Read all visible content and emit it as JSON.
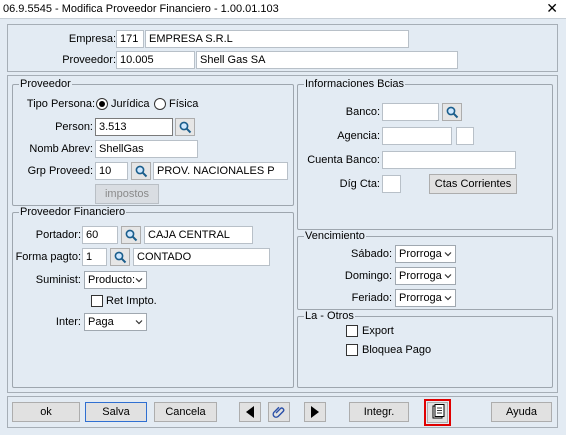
{
  "window": {
    "title": "06.9.5545 - Modifica Proveedor Financiero - 1.00.01.103"
  },
  "header": {
    "empresa_label": "Empresa:",
    "empresa_code": "171",
    "empresa_name": "EMPRESA S.R.L",
    "proveedor_label": "Proveedor:",
    "proveedor_code": "10.005",
    "proveedor_name": "Shell Gas SA"
  },
  "proveedor": {
    "title": "Proveedor",
    "tipo_persona_label": "Tipo Persona:",
    "juridica_label": "Jurídica",
    "fisica_label": "Física",
    "tipo_persona_selected": "Jurídica",
    "person_label": "Person:",
    "person_value": "3.513",
    "nomb_abrev_label": "Nomb Abrev:",
    "nomb_abrev_value": "ShellGas",
    "grp_proveed_label": "Grp Proveed:",
    "grp_proveed_code": "10",
    "grp_proveed_name": "PROV. NACIONALES P",
    "impuestos_label": "impostos"
  },
  "info_bancos": {
    "title": "Informaciones Bcias",
    "banco_label": "Banco:",
    "banco_value": "",
    "agencia_label": "Agencia:",
    "agencia_value": "",
    "agencia_dv": "",
    "cuenta_label": "Cuenta Banco:",
    "cuenta_value": "",
    "digcta_label": "Díg Cta:",
    "digcta_value": "",
    "ctas_corrientes_label": "Ctas Corrientes"
  },
  "proveedor_financiero": {
    "title": "Proveedor Financiero",
    "portador_label": "Portador:",
    "portador_code": "60",
    "portador_name": "CAJA CENTRAL",
    "forma_pago_label": "Forma pagto:",
    "forma_pago_code": "1",
    "forma_pago_name": "CONTADO",
    "suminist_label": "Suminist:",
    "suminist_value": "Producto:",
    "ret_impto_label": "Ret Impto.",
    "ret_impto_checked": false,
    "inter_label": "Inter:",
    "inter_value": "Paga"
  },
  "vencimiento": {
    "title": "Vencimiento",
    "sabado_label": "Sábado:",
    "sabado_value": "Prorroga",
    "domingo_label": "Domingo:",
    "domingo_value": "Prorroga",
    "feriado_label": "Feriado:",
    "feriado_value": "Prorroga"
  },
  "la_otros": {
    "title": "La - Otros",
    "export_label": "Export",
    "export_checked": false,
    "bloquea_pago_label": "Bloquea Pago",
    "bloquea_checked": false
  },
  "toolbar": {
    "ok_label": "ok",
    "salva_label": "Salva",
    "cancela_label": "Cancela",
    "integr_label": "Integr.",
    "ayuda_label": "Ayuda"
  },
  "icons": {
    "lookup": "magnifier-icon",
    "prev": "triangle-left-icon",
    "next": "triangle-right-icon",
    "attach": "paperclip-icon",
    "document": "document-icon",
    "close": "close-icon",
    "dropdown": "chevron-down-icon"
  },
  "colors": {
    "background": "#e3ebf3",
    "highlight_border": "#e00000",
    "focus_border": "#2f6fd1"
  }
}
